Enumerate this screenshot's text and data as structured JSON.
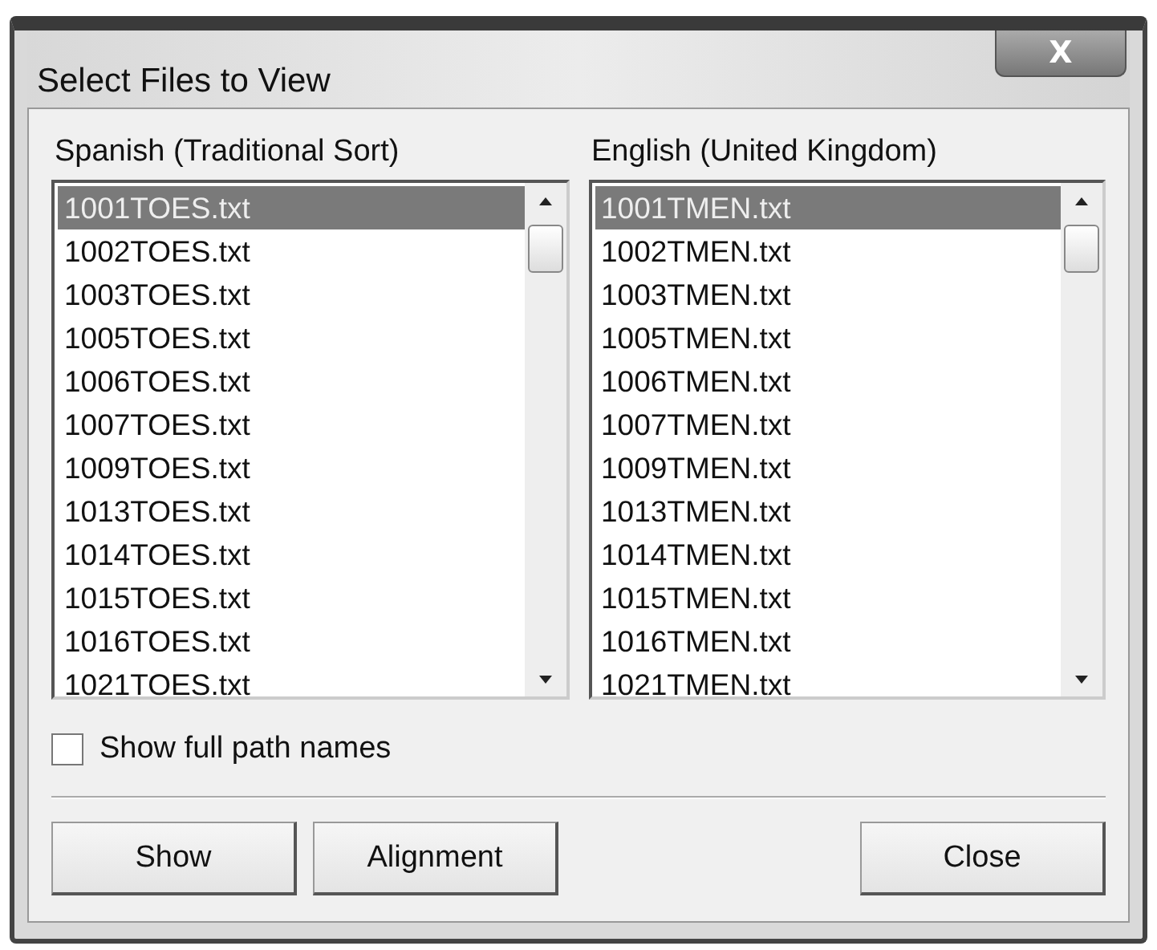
{
  "window": {
    "title": "Select Files to View",
    "close_button": "X"
  },
  "lists": [
    {
      "heading": "Spanish (Traditional Sort)",
      "items": [
        {
          "name": "1001TOES.txt",
          "selected": true
        },
        {
          "name": "1002TOES.txt",
          "selected": false
        },
        {
          "name": "1003TOES.txt",
          "selected": false
        },
        {
          "name": "1005TOES.txt",
          "selected": false
        },
        {
          "name": "1006TOES.txt",
          "selected": false
        },
        {
          "name": "1007TOES.txt",
          "selected": false
        },
        {
          "name": "1009TOES.txt",
          "selected": false
        },
        {
          "name": "1013TOES.txt",
          "selected": false
        },
        {
          "name": "1014TOES.txt",
          "selected": false
        },
        {
          "name": "1015TOES.txt",
          "selected": false
        },
        {
          "name": "1016TOES.txt",
          "selected": false
        },
        {
          "name": "1021TOES.txt",
          "selected": false
        }
      ]
    },
    {
      "heading": "English (United Kingdom)",
      "items": [
        {
          "name": "1001TMEN.txt",
          "selected": true
        },
        {
          "name": "1002TMEN.txt",
          "selected": false
        },
        {
          "name": "1003TMEN.txt",
          "selected": false
        },
        {
          "name": "1005TMEN.txt",
          "selected": false
        },
        {
          "name": "1006TMEN.txt",
          "selected": false
        },
        {
          "name": "1007TMEN.txt",
          "selected": false
        },
        {
          "name": "1009TMEN.txt",
          "selected": false
        },
        {
          "name": "1013TMEN.txt",
          "selected": false
        },
        {
          "name": "1014TMEN.txt",
          "selected": false
        },
        {
          "name": "1015TMEN.txt",
          "selected": false
        },
        {
          "name": "1016TMEN.txt",
          "selected": false
        },
        {
          "name": "1021TMEN.txt",
          "selected": false
        }
      ]
    }
  ],
  "show_full_path": {
    "label": "Show full path names",
    "checked": false
  },
  "buttons": [
    {
      "label": "Show",
      "kind": "left"
    },
    {
      "label": "Alignment",
      "kind": "left"
    },
    {
      "label": "Close",
      "kind": "right"
    }
  ]
}
